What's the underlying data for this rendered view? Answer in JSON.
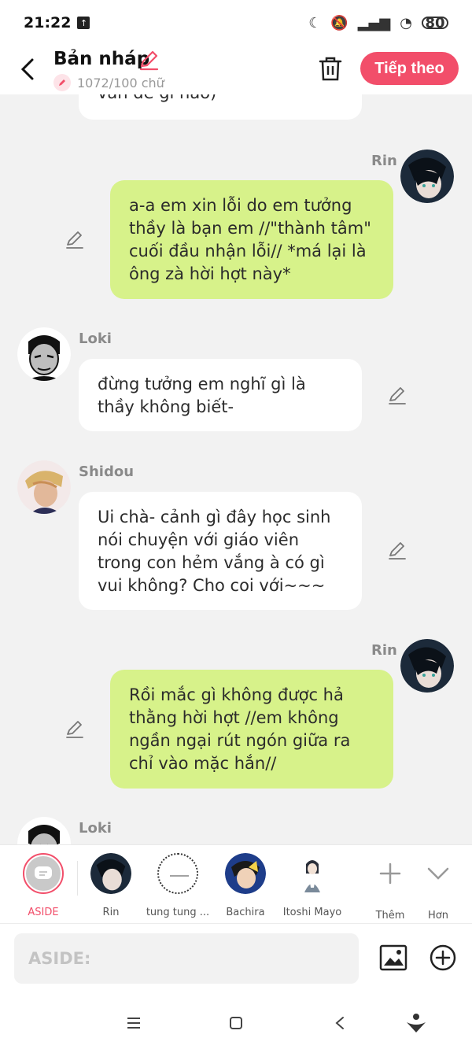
{
  "status_bar": {
    "time": "21:22",
    "battery": "80"
  },
  "header": {
    "title": "Bản nháp",
    "word_count": "1072/100 chữ",
    "next_label": "Tiếp theo"
  },
  "chat": {
    "partial_top_text": "vấn đề gì nào)",
    "messages": [
      {
        "side": "right",
        "sender": "Rin",
        "text": "a-a em xin lỗi do em tưởng thầy là bạn em //\"thành tâm\" cuối đầu nhận lỗi// *má lại là ông zà hời hợt này*"
      },
      {
        "side": "left",
        "sender": "Loki",
        "text": "đừng tưởng em nghĩ gì  là thầy không biết-"
      },
      {
        "side": "left",
        "sender": "Shidou",
        "text": "Ui chà- cảnh gì đây học sinh nói chuyện với giáo viên trong con hẻm vắng à có gì vui không? Cho coi với~~~"
      },
      {
        "side": "right",
        "sender": "Rin",
        "text": "Rồi mắc gì không được hả thằng hời hợt //em không ngần ngại rút ngón giữa ra chỉ vào mặc hắn//"
      },
      {
        "side": "left",
        "sender": "Loki",
        "text": ""
      }
    ]
  },
  "character_bar": {
    "aside_label": "ASIDE",
    "characters": [
      {
        "name": "Rin"
      },
      {
        "name": "tung tung ..."
      },
      {
        "name": "Bachira"
      },
      {
        "name": "Itoshi Mayo"
      }
    ],
    "add_label": "Thêm",
    "more_label": "Hơn"
  },
  "input": {
    "placeholder": "ASIDE:"
  },
  "colors": {
    "accent": "#f24e6a",
    "right_bubble": "#d7f28a",
    "left_bubble": "#ffffff",
    "background": "#f2f2f2"
  }
}
